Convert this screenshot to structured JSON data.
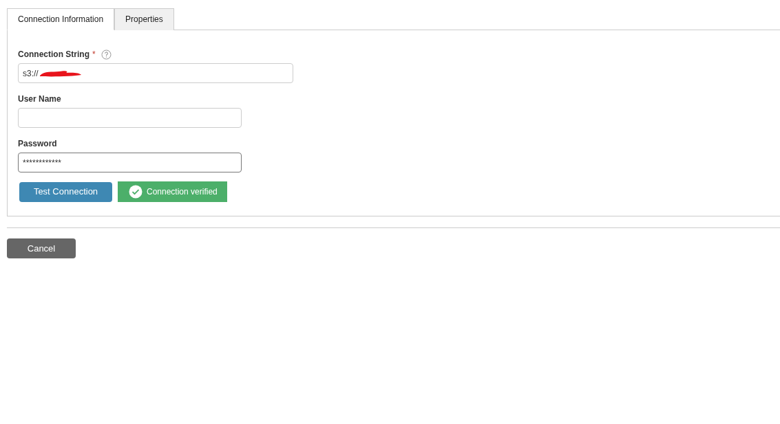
{
  "tabs": [
    {
      "label": "Connection Information",
      "selected": true
    },
    {
      "label": "Properties",
      "selected": false
    }
  ],
  "fields": [
    {
      "label": "Connection String",
      "required_mark": "*",
      "help": true,
      "value": "s3://",
      "redacted": true,
      "focused": false
    },
    {
      "label": "User Name",
      "focused": false
    },
    {
      "label": "Password",
      "value": "************",
      "focused": true
    }
  ],
  "test_button": "Test Connection",
  "status": {
    "text": "Connection verified",
    "kind": "success"
  },
  "cancel_button": "Cancel"
}
